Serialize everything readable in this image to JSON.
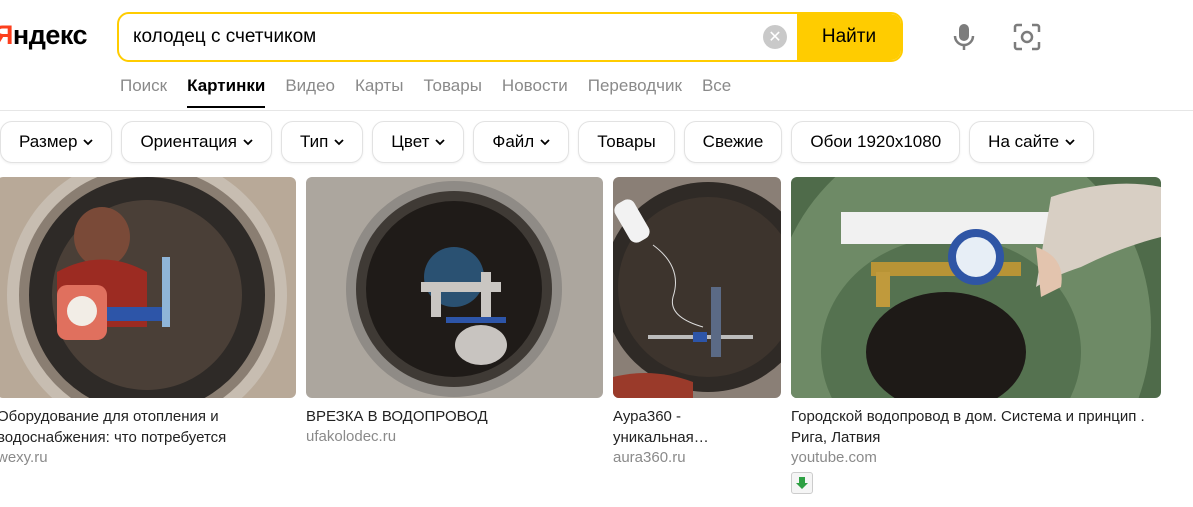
{
  "header": {
    "logo": "Яндекс",
    "search": {
      "value": "колодец с счетчиком",
      "placeholder": "",
      "button": "Найти"
    }
  },
  "tabs": [
    {
      "label": "Поиск",
      "active": false
    },
    {
      "label": "Картинки",
      "active": true
    },
    {
      "label": "Видео",
      "active": false
    },
    {
      "label": "Карты",
      "active": false
    },
    {
      "label": "Товары",
      "active": false
    },
    {
      "label": "Новости",
      "active": false
    },
    {
      "label": "Переводчик",
      "active": false
    },
    {
      "label": "Все",
      "active": false
    }
  ],
  "filters": [
    {
      "label": "Размер",
      "dropdown": true
    },
    {
      "label": "Ориентация",
      "dropdown": true
    },
    {
      "label": "Тип",
      "dropdown": true
    },
    {
      "label": "Цвет",
      "dropdown": true
    },
    {
      "label": "Файл",
      "dropdown": true
    },
    {
      "label": "Товары",
      "dropdown": false
    },
    {
      "label": "Свежие",
      "dropdown": false
    },
    {
      "label": "Обои 1920x1080",
      "dropdown": false
    },
    {
      "label": "На сайте",
      "dropdown": true
    }
  ],
  "results": [
    {
      "title_line1": "Оборудование для отопления и",
      "title_line2": "водоснабжения: что потребуется",
      "host": "wexy.ru",
      "icon": "well-worker-image"
    },
    {
      "title_line1": "ВРЕЗКА В ВОДОПРОВОД",
      "title_line2": "",
      "host": "ufakolodec.ru",
      "icon": "well-pipes-image"
    },
    {
      "title_line1": "Аура360 -",
      "title_line2": "уникальная…",
      "host": "aura360.ru",
      "icon": "well-meter-image"
    },
    {
      "title_line1": "Городской водопровод в дом. Система и принцип .",
      "title_line2": "Рига, Латвия",
      "host": "youtube.com",
      "icon": "green-well-meter-image"
    }
  ],
  "colors": {
    "accent": "#ffcc00",
    "logo_red": "#fc3f1d"
  }
}
